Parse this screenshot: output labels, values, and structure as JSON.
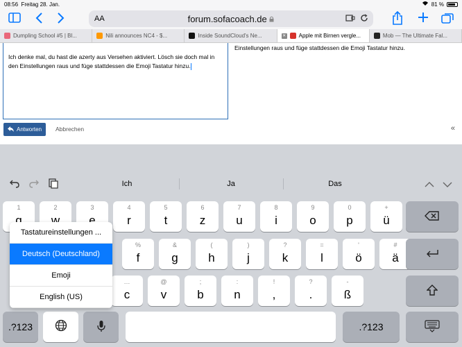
{
  "status": {
    "time": "08:56",
    "date": "Freitag 28. Jan.",
    "battery": "81 %",
    "battery_level": 0.81
  },
  "browser": {
    "aa_label": "AA",
    "url": "forum.sofacoach.de",
    "lock": "🔒",
    "tabs": [
      {
        "title": "Dumpling School #5 | Bl...",
        "color": "#e9677a",
        "active": false
      },
      {
        "title": "Nili announces NC4 - $...",
        "color": "#ff9900",
        "active": false
      },
      {
        "title": "Inside SoundCloud's Ne...",
        "color": "#111111",
        "active": false
      },
      {
        "title": "Apple mit Birnen vergle...",
        "color": "#d6322b",
        "active": true
      },
      {
        "title": "Mob — The Ultimate Fal...",
        "color": "#222222",
        "active": false
      }
    ]
  },
  "editor": {
    "text": "Ich denke mal, du hast die azerty aus Versehen aktiviert. Lösch sie doch mal in den Einstellungen raus und füge stattdessen die Emoji Tastatur hinzu."
  },
  "preview": {
    "text": "Einstellungen raus und füge stattdessen die Emoji Tastatur hinzu."
  },
  "actions": {
    "reply": "Antworten",
    "cancel": "Abbrechen",
    "collapse": "«"
  },
  "predictions": [
    "Ich",
    "Ja",
    "Das"
  ],
  "keyboard": {
    "row1": [
      [
        "1",
        "q"
      ],
      [
        "2",
        "w"
      ],
      [
        "3",
        "e"
      ],
      [
        "4",
        "r"
      ],
      [
        "5",
        "t"
      ],
      [
        "6",
        "z"
      ],
      [
        "7",
        "u"
      ],
      [
        "8",
        "i"
      ],
      [
        "9",
        "o"
      ],
      [
        "0",
        "p"
      ],
      [
        "+",
        "ü"
      ]
    ],
    "row2": [
      [
        "%",
        "f"
      ],
      [
        "&",
        "g"
      ],
      [
        "(",
        "h"
      ],
      [
        ")",
        "j"
      ],
      [
        "?",
        "k"
      ],
      [
        "=",
        "l"
      ],
      [
        "'",
        "ö"
      ],
      [
        "#",
        "ä"
      ]
    ],
    "row3": [
      [
        "…",
        "c"
      ],
      [
        "@",
        "v"
      ],
      [
        ";",
        "b"
      ],
      [
        ":",
        "n"
      ],
      [
        "!",
        ","
      ],
      [
        "?",
        "."
      ],
      [
        "-",
        "ß"
      ]
    ],
    "numbers_label": ".?123"
  },
  "language_menu": [
    "Tastatureinstellungen ...",
    "Deutsch (Deutschland)",
    "Emoji",
    "English (US)"
  ]
}
